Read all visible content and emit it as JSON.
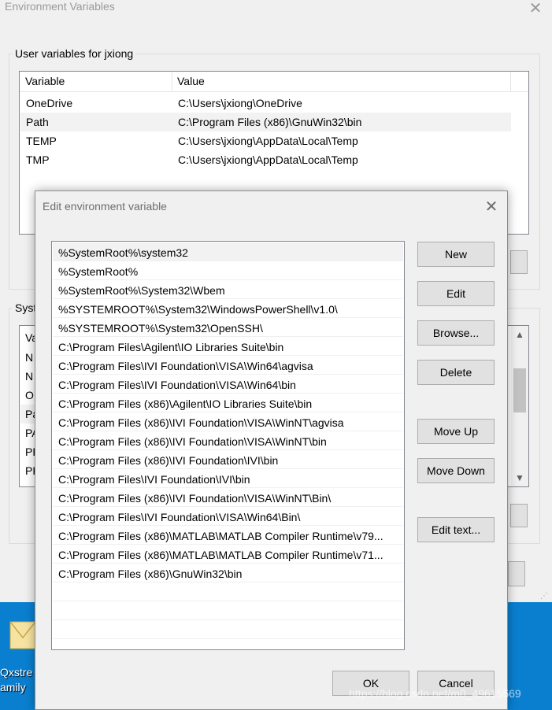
{
  "env_window": {
    "title": "Environment Variables",
    "user_group_label": "User variables for jxiong",
    "user_columns": [
      "Variable",
      "Value"
    ],
    "user_rows": [
      {
        "variable": "OneDrive",
        "value": "C:\\Users\\jxiong\\OneDrive"
      },
      {
        "variable": "Path",
        "value": "C:\\Program Files (x86)\\GnuWin32\\bin"
      },
      {
        "variable": "TEMP",
        "value": "C:\\Users\\jxiong\\AppData\\Local\\Temp"
      },
      {
        "variable": "TMP",
        "value": "C:\\Users\\jxiong\\AppData\\Local\\Temp"
      }
    ],
    "system_group_label_partial": "Syst",
    "system_header_partial": "Va",
    "system_rows_partial": [
      "N",
      "N",
      "O",
      "Pa",
      "PA",
      "PF",
      "PF"
    ]
  },
  "dialog": {
    "title": "Edit environment variable",
    "paths": [
      "%SystemRoot%\\system32",
      "%SystemRoot%",
      "%SystemRoot%\\System32\\Wbem",
      "%SYSTEMROOT%\\System32\\WindowsPowerShell\\v1.0\\",
      "%SYSTEMROOT%\\System32\\OpenSSH\\",
      "C:\\Program Files\\Agilent\\IO Libraries Suite\\bin",
      "C:\\Program Files\\IVI Foundation\\VISA\\Win64\\agvisa",
      "C:\\Program Files\\IVI Foundation\\VISA\\Win64\\bin",
      "C:\\Program Files (x86)\\Agilent\\IO Libraries Suite\\bin",
      "C:\\Program Files (x86)\\IVI Foundation\\VISA\\WinNT\\agvisa",
      "C:\\Program Files (x86)\\IVI Foundation\\VISA\\WinNT\\bin",
      "C:\\Program Files (x86)\\IVI Foundation\\IVI\\bin",
      "C:\\Program Files\\IVI Foundation\\IVI\\bin",
      "C:\\Program Files (x86)\\IVI Foundation\\VISA\\WinNT\\Bin\\",
      "C:\\Program Files\\IVI Foundation\\VISA\\Win64\\Bin\\",
      "C:\\Program Files (x86)\\MATLAB\\MATLAB Compiler Runtime\\v79...",
      "C:\\Program Files (x86)\\MATLAB\\MATLAB Compiler Runtime\\v71...",
      "C:\\Program Files (x86)\\GnuWin32\\bin"
    ],
    "buttons": {
      "new": "New",
      "edit": "Edit",
      "browse": "Browse...",
      "delete": "Delete",
      "move_up": "Move Up",
      "move_down": "Move Down",
      "edit_text": "Edit text...",
      "ok": "OK",
      "cancel": "Cancel"
    }
  },
  "desktop": {
    "icon_label_line1": "Qxstre",
    "icon_label_line2": "amily"
  },
  "watermark": "https://blog.csdn.net/m0_49615569",
  "icons": {
    "close": "close-icon",
    "scroll_up": "chevron-up-icon",
    "scroll_down": "chevron-down-icon",
    "desktop_file": "envelope-icon"
  }
}
